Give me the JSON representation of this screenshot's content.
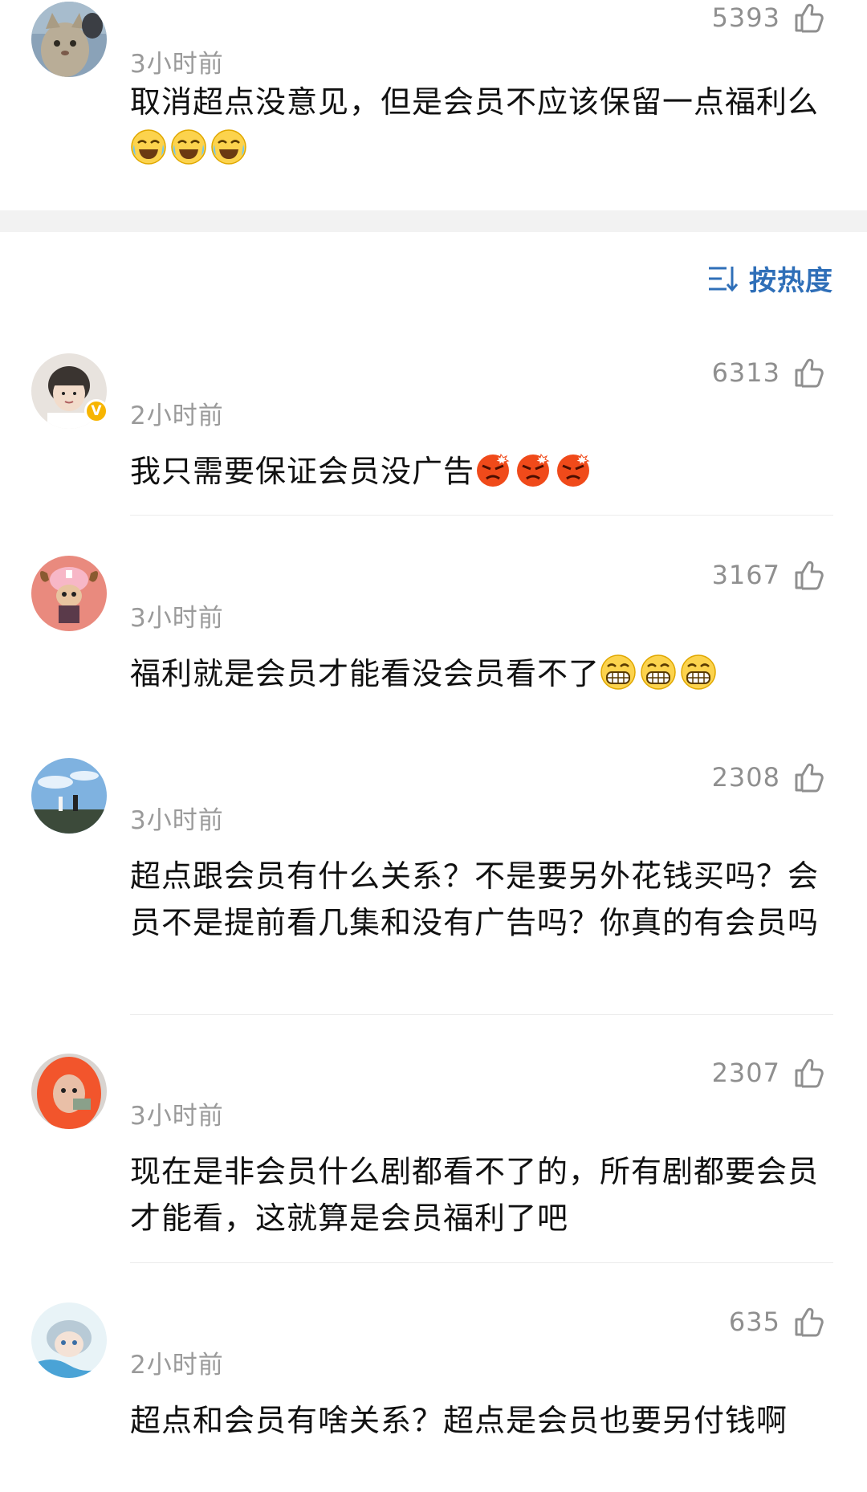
{
  "sort": {
    "label": "按热度",
    "icon": "sort-icon",
    "color": "#2f6fb8"
  },
  "comments": [
    {
      "time": "3小时前",
      "likes": "5393",
      "text": "取消超点没意见，但是会员不应该保留一点福利么",
      "emoji": "laugh-cry-emoji",
      "emoji_count": 3
    },
    {
      "time": "2小时前",
      "likes": "6313",
      "text": "我只需要保证会员没广告",
      "emoji": "angry-emoji",
      "emoji_count": 3,
      "verified": "V"
    },
    {
      "time": "3小时前",
      "likes": "3167",
      "text": "福利就是会员才能看没会员看不了",
      "emoji": "grin-emoji",
      "emoji_count": 3
    },
    {
      "time": "3小时前",
      "likes": "2308",
      "text": "超点跟会员有什么关系？不是要另外花钱买吗？会员不是提前看几集和没有广告吗？你真的有会员吗"
    },
    {
      "time": "3小时前",
      "likes": "2307",
      "text": "现在是非会员什么剧都看不了的，所有剧都要会员才能看，这就算是会员福利了吧"
    },
    {
      "time": "2小时前",
      "likes": "635",
      "text": "超点和会员有啥关系？超点是会员也要另付钱啊"
    }
  ]
}
